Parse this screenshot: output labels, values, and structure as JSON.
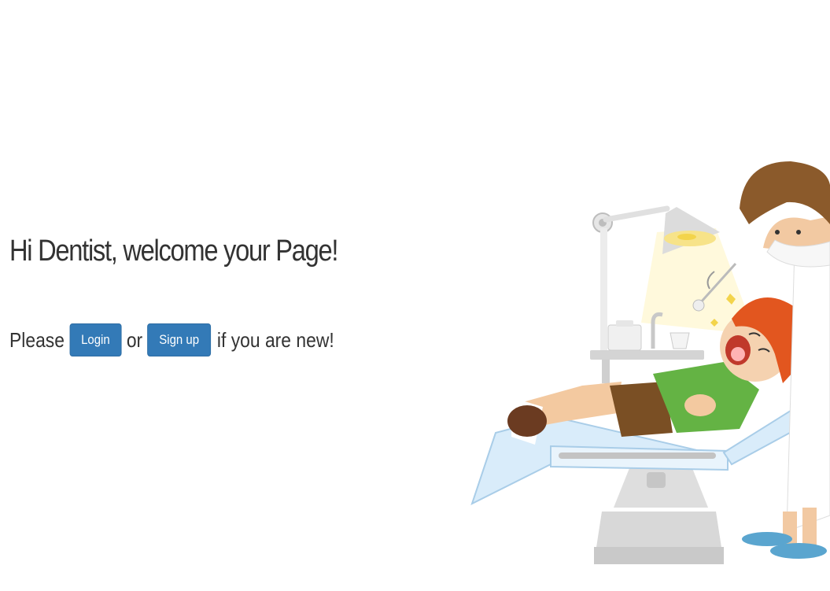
{
  "welcome": {
    "heading": "Hi Dentist, welcome your Page!"
  },
  "cta": {
    "prefix": "Please",
    "login_label": "Login",
    "middle": "or",
    "signup_label": "Sign up",
    "suffix": "if you are new!"
  },
  "illustration": {
    "subject": "dentist-treating-child-illustration"
  },
  "colors": {
    "primary": "#337ab7",
    "text": "#333333",
    "background": "#ffffff"
  }
}
